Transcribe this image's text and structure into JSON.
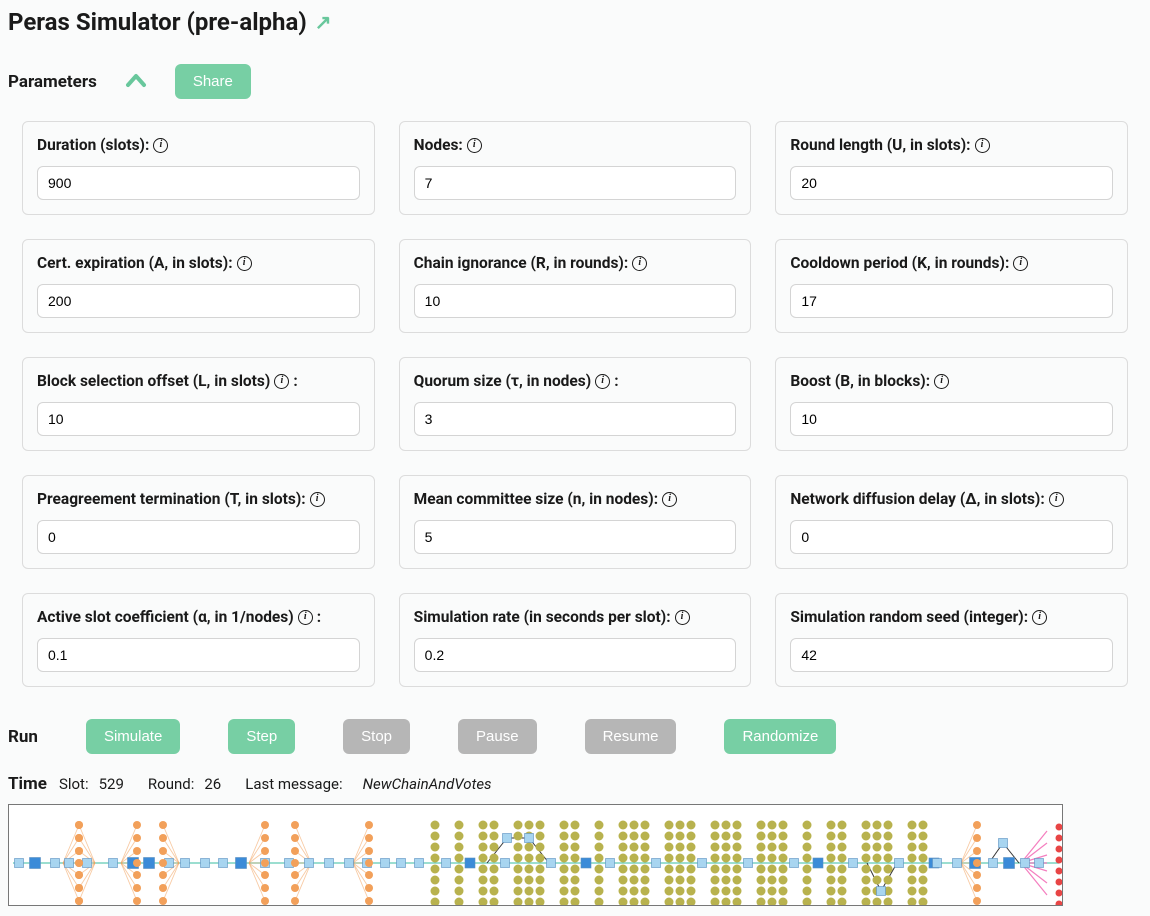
{
  "title": "Peras Simulator (pre-alpha)",
  "sections": {
    "parameters": "Parameters",
    "run": "Run",
    "time": "Time"
  },
  "shareLabel": "Share",
  "params": [
    {
      "id": "duration",
      "label": "Duration (slots):",
      "value": "900",
      "afterIcon": false
    },
    {
      "id": "nodes",
      "label": "Nodes:",
      "value": "7",
      "afterIcon": false
    },
    {
      "id": "roundLength",
      "label": "Round length (U, in slots):",
      "value": "20",
      "afterIcon": false
    },
    {
      "id": "certExpiration",
      "label": "Cert. expiration (A, in slots):",
      "value": "200",
      "afterIcon": false
    },
    {
      "id": "chainIgnorance",
      "label": "Chain ignorance (R, in rounds):",
      "value": "10",
      "afterIcon": false
    },
    {
      "id": "cooldown",
      "label": "Cooldown period (K, in rounds):",
      "value": "17",
      "afterIcon": false
    },
    {
      "id": "blockSelection",
      "label": "Block selection offset (L, in slots)",
      "value": "10",
      "afterIcon": true
    },
    {
      "id": "quorum",
      "label": "Quorum size (τ, in nodes)",
      "value": "3",
      "afterIcon": true
    },
    {
      "id": "boost",
      "label": "Boost (B, in blocks):",
      "value": "10",
      "afterIcon": false
    },
    {
      "id": "preagreement",
      "label": "Preagreement termination (T, in slots):",
      "value": "0",
      "afterIcon": false
    },
    {
      "id": "committee",
      "label": "Mean committee size (n, in nodes):",
      "value": "5",
      "afterIcon": false
    },
    {
      "id": "diffusion",
      "label": "Network diffusion delay (Δ, in slots):",
      "value": "0",
      "afterIcon": false
    },
    {
      "id": "activeSlot",
      "label": "Active slot coefficient (α, in 1/nodes)",
      "value": "0.1",
      "afterIcon": true
    },
    {
      "id": "simRate",
      "label": "Simulation rate (in seconds per slot):",
      "value": "0.2",
      "afterIcon": false
    },
    {
      "id": "seed",
      "label": "Simulation random seed (integer):",
      "value": "42",
      "afterIcon": false
    }
  ],
  "runButtons": {
    "simulate": "Simulate",
    "step": "Step",
    "stop": "Stop",
    "pause": "Pause",
    "resume": "Resume",
    "randomize": "Randomize"
  },
  "time": {
    "slotLabel": "Slot:",
    "slotValue": "529",
    "roundLabel": "Round:",
    "roundValue": "26",
    "lastMessageLabel": "Last message:",
    "lastMessageValue": "NewChainAndVotes"
  },
  "colors": {
    "green": "#77cfa4",
    "gray": "#b6b6b6",
    "orange": "#f2a05a",
    "olive": "#b8b24e",
    "lightBlue": "#a8d5f0",
    "midBlue": "#3b8bd8",
    "teal": "#5fc9b3",
    "pink": "#f25fb0",
    "red": "#e84545"
  }
}
